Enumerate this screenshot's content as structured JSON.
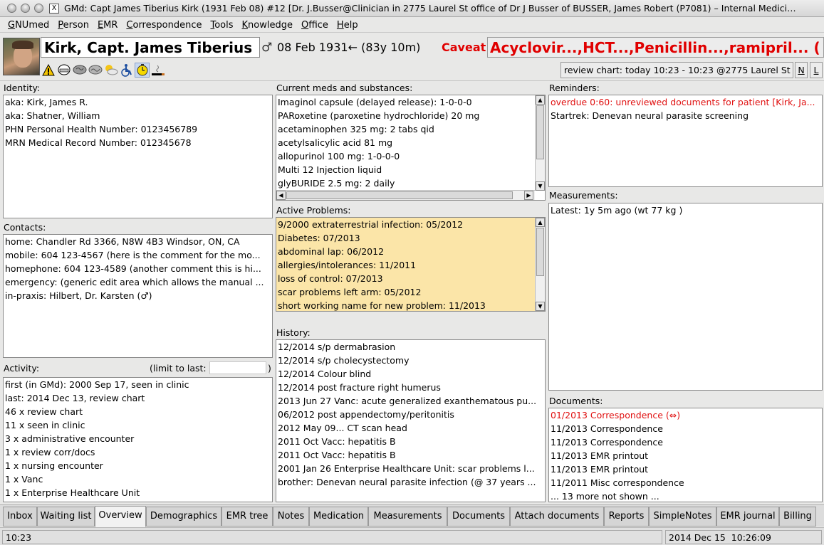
{
  "window": {
    "title": "GMd: Capt James Tiberius Kirk (1931 Feb 08) #12 [Dr. J.Busser@Clinician in 2775 Laurel St office of Dr J Busser of BUSSER, James Robert (P7081) – Internal Medici…",
    "x_icon": "X"
  },
  "menu": [
    "GNUmed",
    "Person",
    "EMR",
    "Correspondence",
    "Tools",
    "Knowledge",
    "Office",
    "Help"
  ],
  "patient": {
    "name": "Kirk, Capt. James Tiberius",
    "sex": "♂",
    "dob": "08 Feb 1931",
    "age": "←  (83y 10m)",
    "caveat_label": "Caveat",
    "allergies": "Acyclovir...,HCT...,Penicillin...,ramipril... (",
    "review": "review chart: today 10:23 - 10:23 @2775 Laurel St",
    "btn_n": "N",
    "btn_l": "L"
  },
  "icons": [
    "warning-icon",
    "helmet-icon",
    "brain-icon",
    "brain-gray-icon",
    "weather-icon",
    "wheelchair-icon",
    "stopwatch-icon",
    "smoking-icon"
  ],
  "identity": {
    "label": "Identity:",
    "lines": [
      "aka: Kirk, James R.",
      "aka: Shatner, William",
      "PHN Personal Health Number: 0123456789",
      "MRN Medical Record Number: 012345678"
    ]
  },
  "contacts": {
    "label": "Contacts:",
    "lines": [
      "home: Chandler Rd 3366, N8W 4B3 Windsor, ON, CA",
      "mobile: 604 123-4567 (here is the comment for the mo...",
      "homephone: 604 123-4589 (another comment this is hi...",
      "emergency: (generic edit area which allows the manual ...",
      "in-praxis: Hilbert, Dr. Karsten (♂)"
    ]
  },
  "activity": {
    "label": "Activity:",
    "limit_label": "(limit to last:",
    "limit_close": ")",
    "lines": [
      "first (in GMd): 2000 Sep 17, seen in clinic",
      "last: 2014 Dec 13, review chart",
      " 46 x review chart",
      " 11 x seen in clinic",
      " 3 x administrative encounter",
      " 1 x review corr/docs",
      " 1 x nursing encounter",
      " 1 x Vanc",
      " 1 x Enterprise Healthcare Unit"
    ]
  },
  "meds": {
    "label": "Current meds and substances:",
    "lines": [
      "Imaginol capsule (delayed release): 1-0-0-0",
      "PARoxetine (paroxetine hydrochloride) 20 mg",
      "acetaminophen 325 mg: 2 tabs qid",
      "acetylsalicylic acid 81 mg",
      "allopurinol 100 mg: 1-0-0-0",
      "Multi 12 Injection liquid",
      "glyBURIDE 2.5 mg: 2 daily"
    ]
  },
  "problems": {
    "label": "Active Problems:",
    "lines": [
      "9/2000 extraterrestrial infection: 05/2012",
      "Diabetes: 07/2013",
      "abdominal lap: 06/2012",
      "allergies/intolerances: 11/2011",
      "loss of control: 07/2013",
      "scar problems left arm: 05/2012",
      "short working name for new problem: 11/2013"
    ]
  },
  "history": {
    "label": "History:",
    "lines": [
      "12/2014 s/p dermabrasion",
      "12/2014 s/p cholecystectomy",
      "12/2014 Colour blind",
      "12/2014 post fracture right humerus",
      "2013 Jun 27 Vanc: acute generalized exanthematous pu...",
      "06/2012 post appendectomy/peritonitis",
      "2012 May 09... CT scan head",
      "2011 Oct Vacc: hepatitis B",
      "2011 Oct Vacc: hepatitis B",
      "2001 Jan 26 Enterprise Healthcare Unit: scar problems l...",
      "brother: Denevan neural parasite infection (@ 37 years ..."
    ]
  },
  "reminders": {
    "label": "Reminders:",
    "overdue": "overdue 0:60: unreviewed documents for patient [Kirk, Ja...",
    "lines": [
      "Startrek: Denevan neural parasite screening"
    ]
  },
  "measurements": {
    "label": "Measurements:",
    "lines": [
      "Latest: 1y 5m ago (wt 77 kg )"
    ]
  },
  "documents": {
    "label": "Documents:",
    "first": "01/2013 Correspondence (⇔)",
    "lines": [
      "11/2013 Correspondence",
      "11/2013 Correspondence",
      "11/2013 EMR printout",
      "11/2013 EMR printout",
      "11/2011 Misc correspondence",
      "... 13 more not shown ..."
    ]
  },
  "tabs": [
    "Inbox",
    "Waiting list",
    "Overview",
    "Demographics",
    "EMR tree",
    "Notes",
    "Medication",
    "Measurements",
    "Documents",
    "Attach documents",
    "Reports",
    "SimpleNotes",
    "EMR journal",
    "Billing"
  ],
  "active_tab": "Overview",
  "status": {
    "left": "10:23",
    "right": "2014 Dec 15  10:26:09"
  }
}
